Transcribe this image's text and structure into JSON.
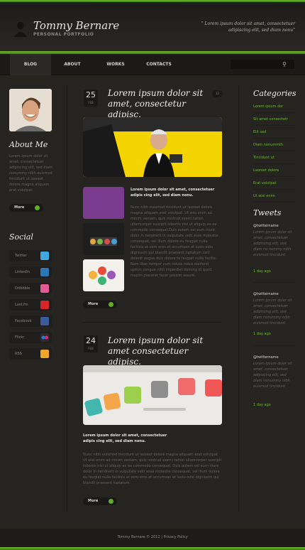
{
  "header": {
    "name": "Tommy Bernare",
    "subtitle": "PERSONAL PORTFOLIO",
    "quote": "\" Lorem ipsum dolor sit amet, consectetuer adipiscing elit, sed diam nonu\""
  },
  "nav": {
    "items": [
      "BLOG",
      "ABOUT",
      "WORKS",
      "CONTACTS"
    ]
  },
  "about": {
    "title": "About Me",
    "text": "Lorem ipsum dolor sit amet, consectetuer adipiscing elit, sed diam nonummy nibh euismod tincidunt ut laoreet dolore magna aliquam erat volutpat.",
    "more": "More"
  },
  "social": {
    "title": "Social",
    "items": [
      "Twitter",
      "LinkedIn",
      "Dribbble",
      "Last.fm",
      "Facebook",
      "Flickr",
      "RSS"
    ]
  },
  "posts": [
    {
      "day": "25",
      "month": "FEB",
      "title": "Lorem ipsum dolor sit amet, consectetur adipisc.",
      "comments": "12",
      "lead": "Lorem ipsum dolor sit amet, consectetuer adipis cing elit, sed diam nonu.",
      "body": "Nunc nibh euismod tincidunt ut laoreet dolore magna aliquam erat volutpat. Ut wisi enim ad minim veniam, quis nostrud exerci tation ullamcorper suscipit lobortis nisl ut aliquip ex ea commodo consequat.Duis autem vel eum iriure dolor in hendrerit in vulputate velit esse molestie consequat, vel illum dolore eu feugiat nulla facilisis at vero eros et accumsan et iusto odio dignissim qui blandit praesent luptatum zzril delenit augue duis dolore te feugait nulla facilisi. Nam liber tempor cum soluta nobis eleifend option congue nihil imperdiet doming id quod mazim placerat facer possim assum.",
      "more": "More"
    },
    {
      "day": "24",
      "month": "FEB",
      "title": "Lorem ipsum dolor sit amet consectetuer adipisc.",
      "comments": "",
      "lead": "Lorem ipsum dolor sit amet, consectetuer adipis cing elit, sed diam nonu.",
      "body": "Nunc nibh euismod tincidunt ut laoreet dolore magna aliquam erat volutpat. Ut wisi enim ad minim veniam, quis nostrud exerci tation ullamcorper suscipit lobortis nisl ut aliquip ex ea commodo consequat. Duis autem vel eum iriure dolor in hendrerit in vulputate velit esse molestie consequat, vel illum dolore eu feugiat nulla facilisis at vero eros et accumsan et iusto odio dignissim qui blandit praesent luptatum.",
      "more": "More"
    }
  ],
  "categories": {
    "title": "Categories",
    "items": [
      "Lorem ipsum dor",
      "Sit amet consectetr",
      "Elit sed",
      "Diam nonummth",
      "Tincidunt ut",
      "Laoreet dolore",
      "Erat volutpat",
      "Ut wisi enim"
    ]
  },
  "tweets": {
    "title": "Tweets",
    "items": [
      {
        "user": "@twittername",
        "text": "Lorem ipsum dolor sit amet, consectetuer adipiscing elit, sed diam no nummy nibh euismod tincidunt.",
        "time": "1 day ago"
      },
      {
        "user": "@twittername",
        "text": "Lorem ipsum dolor sit amet, consectetuer adipiscing elit, sed diam nonummy nibh euismod tincidunt.",
        "time": "1 day ago"
      },
      {
        "user": "@twittername",
        "text": "Lorem ipsum dolor sit amet, consectetuer adipiscing elit, sed diam nonummy nibh euismod tincidunt.",
        "time": "1 day ago"
      }
    ]
  },
  "footer": {
    "text": "Tommy Bernare © 2012 | Privacy Policy"
  },
  "colors": {
    "accent": "#6fb634",
    "background": "#262421"
  }
}
